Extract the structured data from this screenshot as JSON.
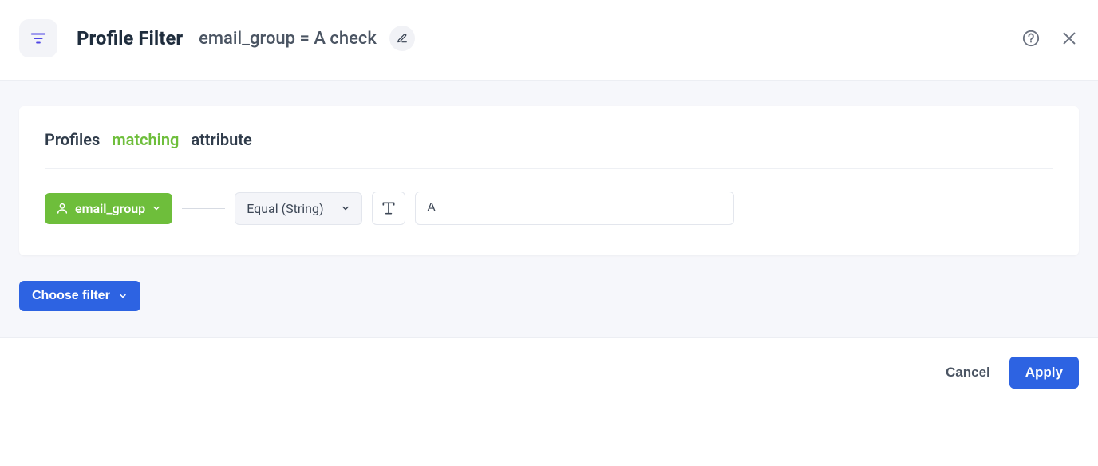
{
  "header": {
    "page_title": "Profile Filter",
    "filter_name": "email_group = A check"
  },
  "card": {
    "profiles_label": "Profiles",
    "matching_label": "matching",
    "attribute_label": "attribute",
    "condition": {
      "attribute": "email_group",
      "operator": "Equal (String)",
      "value": "A",
      "value_placeholder": ""
    }
  },
  "actions": {
    "choose_filter": "Choose filter"
  },
  "footer": {
    "cancel": "Cancel",
    "apply": "Apply"
  },
  "colors": {
    "accent_green": "#6ebe3b",
    "accent_blue": "#2d63e2",
    "bg_muted": "#f6f7fb"
  }
}
